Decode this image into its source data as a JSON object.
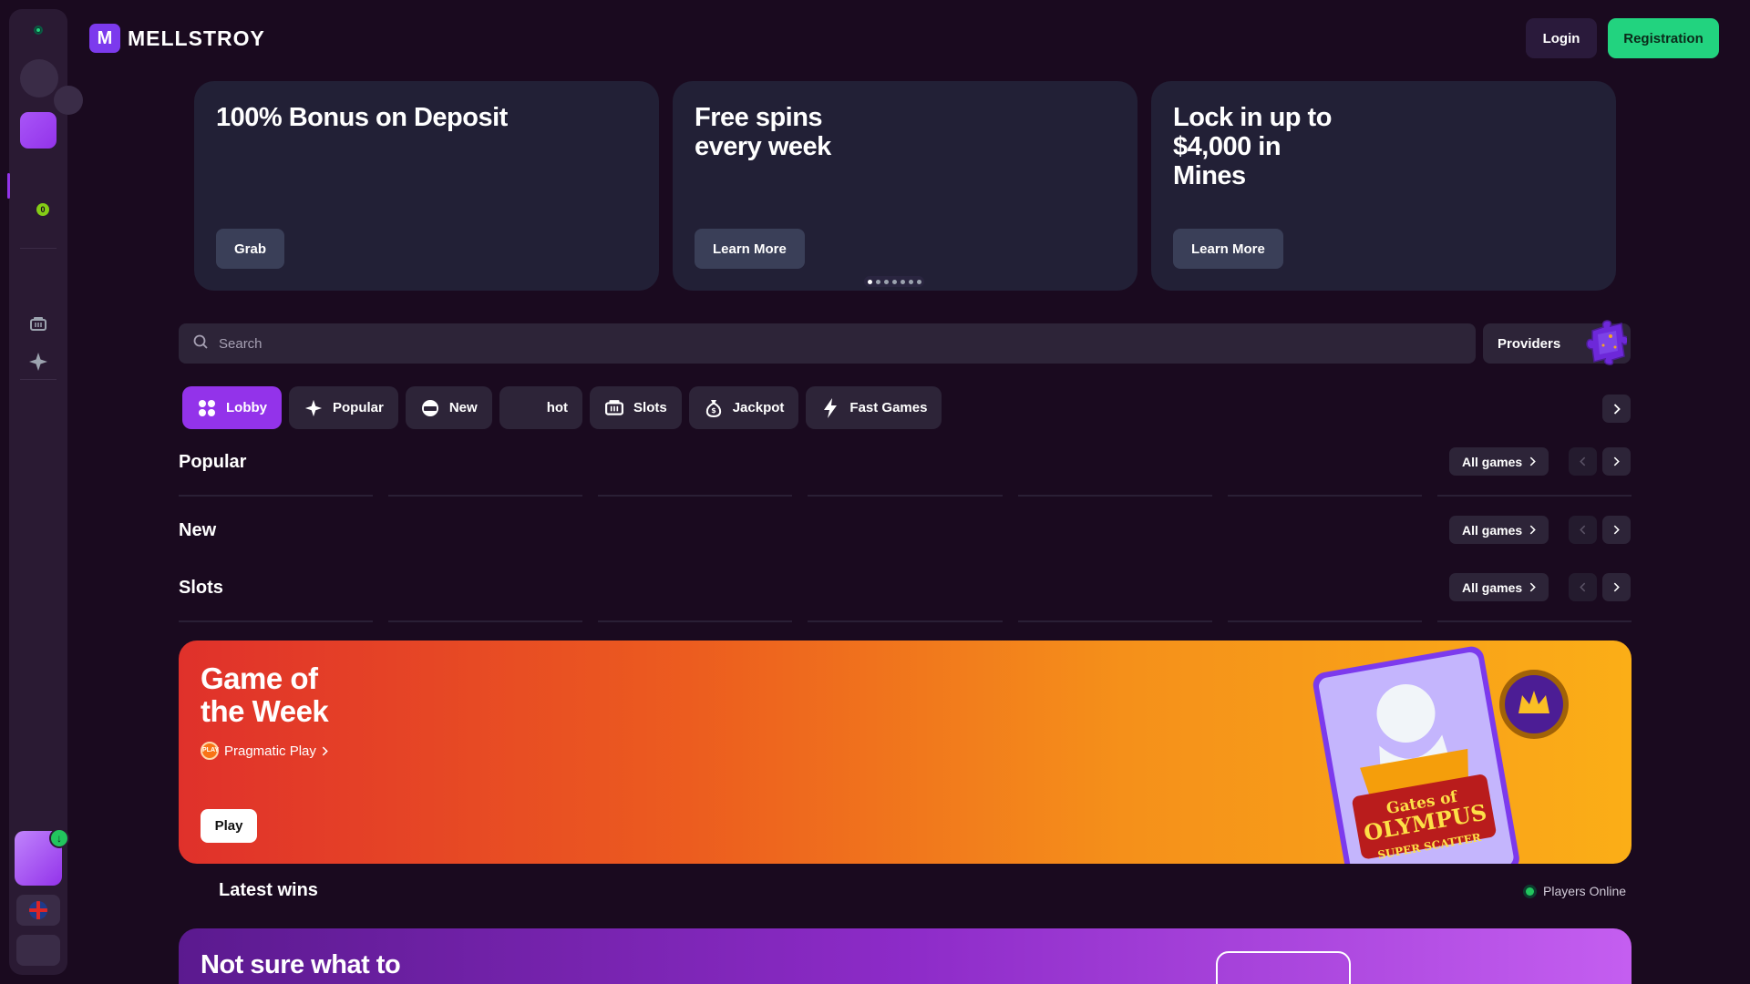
{
  "header": {
    "logo_text": "MELLSTROY",
    "logo_mark": "M",
    "login_label": "Login",
    "registration_label": "Registration"
  },
  "sidebar": {
    "counter": "0",
    "icons": [
      "slot-machine-icon",
      "sparkle-icon"
    ]
  },
  "promos": [
    {
      "title": "100% Bonus on Deposit",
      "button": "Grab"
    },
    {
      "title": "Free spins every week",
      "button": "Learn More"
    },
    {
      "title": "Lock in up to $4,000 in Mines",
      "button": "Learn More"
    }
  ],
  "carousel": {
    "dot_count": 7,
    "active_index": 0
  },
  "search": {
    "placeholder": "Search"
  },
  "providers_label": "Providers",
  "tabs": [
    {
      "label": "Lobby",
      "icon": "grid-icon",
      "active": true
    },
    {
      "label": "Popular",
      "icon": "sparkle-icon"
    },
    {
      "label": "New",
      "icon": "new-badge-icon"
    },
    {
      "label": "hot",
      "icon": ""
    },
    {
      "label": "Slots",
      "icon": "slot-machine-icon"
    },
    {
      "label": "Jackpot",
      "icon": "money-bag-icon"
    },
    {
      "label": "Fast Games",
      "icon": "lightning-icon"
    }
  ],
  "sections": [
    {
      "title": "Popular",
      "all_games": "All games"
    },
    {
      "title": "New",
      "all_games": "All games"
    },
    {
      "title": "Slots",
      "all_games": "All games"
    }
  ],
  "game_of_week": {
    "title_line1": "Game of",
    "title_line2": "the Week",
    "provider": "Pragmatic Play",
    "provider_logo_text": "PLAY",
    "play_label": "Play",
    "game_art_text_line1": "Gates of",
    "game_art_text_line2": "OLYMPUS",
    "game_art_text_line3": "SUPER SCATTER"
  },
  "latest_wins": {
    "title": "Latest wins",
    "online_label": "Players Online"
  },
  "banner": {
    "title": "Not sure what to"
  },
  "colors": {
    "accent_purple": "#9333ea",
    "accent_green": "#22d37f",
    "background": "#1a0a1f"
  }
}
